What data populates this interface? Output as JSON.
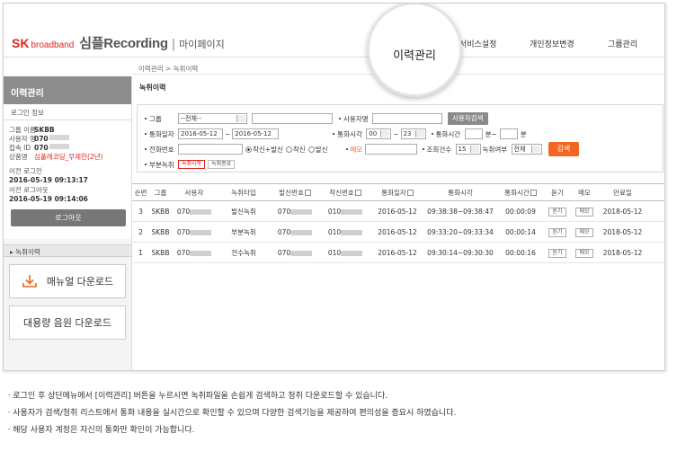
{
  "header": {
    "logo_sk": "SK",
    "logo_brand": "broadband",
    "service_name": "심플Recording",
    "separator": "|",
    "mypage": "마이페이지",
    "nav": [
      "이력관리",
      "서비스설정",
      "개인정보변경",
      "그룹관리"
    ]
  },
  "sidebar": {
    "title": "이력관리",
    "login_info_label": "로그인 정보",
    "info": [
      {
        "key": "그룹 이름",
        "value": "SKBB"
      },
      {
        "key": "사용자 명",
        "value": "070"
      },
      {
        "key": "접속 ID",
        "value": "070"
      },
      {
        "key": "상품명",
        "value": "심플레코딩_무제한(2년)"
      }
    ],
    "prev_login_label": "이전 로그인",
    "prev_login": "2016-05-19 09:13:17",
    "prev_logout_label": "이전 로그아웃",
    "prev_logout": "2016-05-19 09:14:06",
    "logout_button": "로그아웃",
    "menu_item": "녹취이력",
    "manual_download": "매뉴얼 다운로드",
    "bulk_download": "대용량 음원 다운로드"
  },
  "main": {
    "breadcrumb": "이력관리 > 녹취이력",
    "title": "녹취이력",
    "search": {
      "group_label": "그룹",
      "group_value": "--전체--",
      "user_label": "사용자명",
      "user_search_button": "사용자검색",
      "date_label": "통화일자",
      "date_from": "2016-05-12",
      "date_to": "2016-05-12",
      "tilde": "~",
      "time_label": "통화시각",
      "time_from": "00",
      "time_to": "23",
      "duration_label": "통화시간",
      "minute_unit": "분~",
      "minute_unit2": "분",
      "phone_label": "전화번호",
      "radio_options": [
        "착신+발신",
        "착신",
        "발신"
      ],
      "memo_label": "메모",
      "count_label": "조회건수",
      "count_value": "15",
      "record_label": "녹취여부",
      "record_value": "전체",
      "search_button": "검색",
      "partial_label": "부분녹취",
      "partial_start": "녹취시작",
      "partial_end": "녹취종료"
    },
    "table": {
      "headers": [
        "순번",
        "그룹",
        "사용자",
        "녹취타입",
        "발신번호",
        "착신번호",
        "통화일자",
        "통화시각",
        "통화시간",
        "듣기",
        "메모",
        "만료일"
      ],
      "rows": [
        {
          "no": "3",
          "group": "SKBB",
          "user": "070",
          "type": "발신녹취",
          "from": "070",
          "to": "010",
          "date": "2016-05-12",
          "time": "09:38:38~09:38:47",
          "duration": "00:00:09",
          "listen": "듣기",
          "memo": "메모",
          "expire": "2018-05-12"
        },
        {
          "no": "2",
          "group": "SKBB",
          "user": "070",
          "type": "부분녹취",
          "from": "070",
          "to": "010",
          "date": "2016-05-12",
          "time": "09:33:20~09:33:34",
          "duration": "00:00:14",
          "listen": "듣기",
          "memo": "메모",
          "expire": "2018-05-12"
        },
        {
          "no": "1",
          "group": "SKBB",
          "user": "070",
          "type": "전수녹취",
          "from": "070",
          "to": "010",
          "date": "2016-05-12",
          "time": "09:30:14~09:30:30",
          "duration": "00:00:16",
          "listen": "듣기",
          "memo": "메모",
          "expire": "2018-05-12"
        }
      ]
    }
  },
  "notes": [
    "ㆍ로그인 후 상단메뉴에서 [이력관리] 버튼을 누르시면 녹취파일을 손쉽게 검색하고 청취 다운로드할 수 있습니다.",
    "ㆍ사용자가 검색/청취 리스트에서 통화 내용을 실시간으로 확인할 수 있으며 다양한 검색기능을 제공하여 편의성을 증요시 하였습니다.",
    "ㆍ해당 사용자 계정은 자신의 통화만 확인이 가능합니다."
  ],
  "colors": {
    "brand_red": "#e2231a",
    "accent_orange": "#f26522",
    "sidebar_title": "#8d8d8d"
  }
}
